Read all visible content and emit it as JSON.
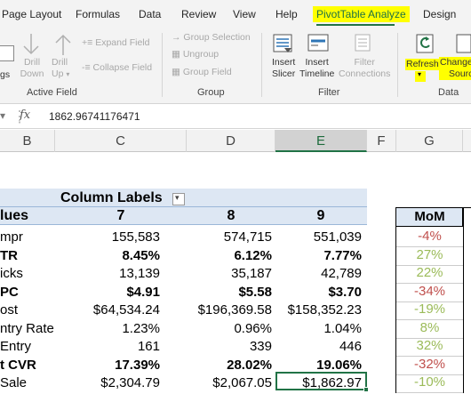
{
  "tabs": [
    "Page Layout",
    "Formulas",
    "Data",
    "Review",
    "View",
    "Help",
    "PivotTable Analyze",
    "Design"
  ],
  "ribbon": {
    "partial_left": "gs",
    "drill_down": [
      "Drill",
      "Down"
    ],
    "drill_up": [
      "Drill",
      "Up"
    ],
    "expand_field": "Expand Field",
    "collapse_field": "Collapse Field",
    "active_field_group": "Active Field",
    "group_selection": "Group Selection",
    "ungroup": "Ungroup",
    "group_field": "Group Field",
    "group_group": "Group",
    "insert_slicer": [
      "Insert",
      "Slicer"
    ],
    "insert_timeline": [
      "Insert",
      "Timeline"
    ],
    "filter_connections": [
      "Filter",
      "Connections"
    ],
    "filter_group": "Filter",
    "refresh": "Refresh",
    "change_source": [
      "Change",
      "Source"
    ],
    "data_group": "Data"
  },
  "formula_bar": {
    "fx": "fx",
    "value": "1862.96741176471"
  },
  "columns": [
    "B",
    "C",
    "D",
    "E",
    "F",
    "G"
  ],
  "pivot": {
    "column_labels": "Column Labels",
    "values_header": "lues",
    "col_headers": [
      "7",
      "8",
      "9"
    ],
    "rows": [
      {
        "label": "mpr",
        "v": [
          "155,583",
          "574,715",
          "551,039"
        ],
        "bold": false
      },
      {
        "label": "TR",
        "v": [
          "8.45%",
          "6.12%",
          "7.77%"
        ],
        "bold": true
      },
      {
        "label": "icks",
        "v": [
          "13,139",
          "35,187",
          "42,789"
        ],
        "bold": false
      },
      {
        "label": "PC",
        "v": [
          "$4.91",
          "$5.58",
          "$3.70"
        ],
        "bold": true
      },
      {
        "label": "ost",
        "v": [
          "$64,534.24",
          "$196,369.58",
          "$158,352.23"
        ],
        "bold": false
      },
      {
        "label": "ntry Rate",
        "v": [
          "1.23%",
          "0.96%",
          "1.04%"
        ],
        "bold": false
      },
      {
        "label": "Entry",
        "v": [
          "161",
          "339",
          "446"
        ],
        "bold": false
      },
      {
        "label": "t CVR",
        "v": [
          "17.39%",
          "28.02%",
          "19.06%"
        ],
        "bold": true
      },
      {
        "label": "Sale",
        "v": [
          "$2,304.79",
          "$2,067.05",
          "$1,862.97"
        ],
        "bold": false
      }
    ]
  },
  "mom": {
    "header": "MoM",
    "values": [
      "-4%",
      "27%",
      "22%",
      "-34%",
      "-19%",
      "8%",
      "32%",
      "-32%",
      "-10%"
    ],
    "colors": [
      "#c0504d",
      "#9bbb59",
      "#9bbb59",
      "#c0504d",
      "#9bbb59",
      "#9bbb59",
      "#9bbb59",
      "#c0504d",
      "#9bbb59"
    ]
  }
}
